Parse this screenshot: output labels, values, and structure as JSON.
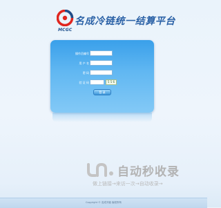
{
  "logo": {
    "abbr": "MCGC",
    "title": "名成冷链统一结算平台",
    "accent_red": "#e0261f",
    "accent_blue": "#2b62a7"
  },
  "login_form": {
    "fields": [
      {
        "label": "操作员编号",
        "value": ""
      },
      {
        "label": "用 户 名",
        "value": ""
      },
      {
        "label": "密    码",
        "value": ""
      },
      {
        "label": "验 证 码",
        "value": ""
      }
    ],
    "captcha_text": "5 5 6",
    "submit_label": "登 录",
    "panel_color": "#4aaaf0"
  },
  "watermark": {
    "title": "自动秒收录",
    "subtitle": "做上链接→来访一次→自动收录→"
  },
  "footer": {
    "text": "Copyright © 名成冷链 版权所有"
  }
}
